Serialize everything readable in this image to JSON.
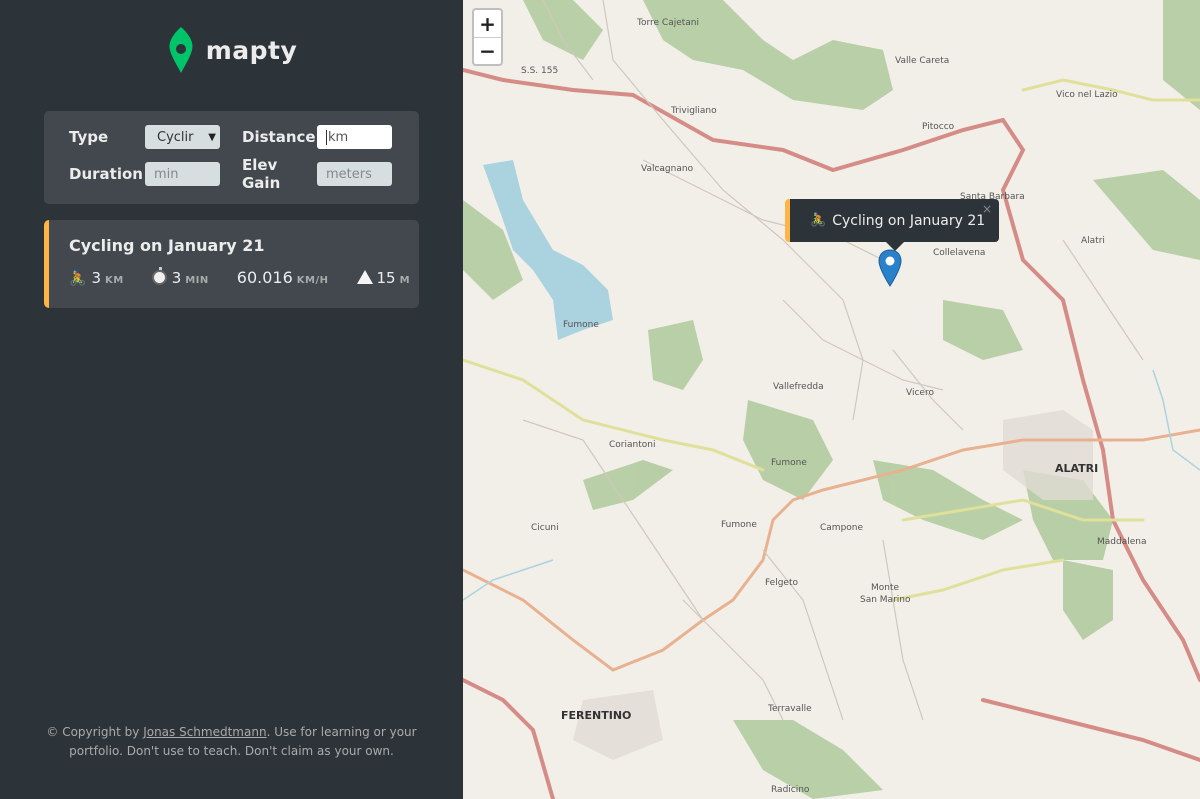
{
  "app": {
    "name": "mapty",
    "brand_color": "#00c46a",
    "accent_cycling": "#ffb545"
  },
  "form": {
    "type_label": "Type",
    "type_value": "Cyclir",
    "distance_label": "Distance",
    "distance_placeholder": "km",
    "duration_label": "Duration",
    "duration_placeholder": "min",
    "elev_label": "Elev Gain",
    "elev_placeholder": "meters"
  },
  "workouts": [
    {
      "title": "Cycling on January 21",
      "distance": "3",
      "distance_unit": "km",
      "duration": "3",
      "duration_unit": "min",
      "speed": "60.016",
      "speed_unit": "km/h",
      "elev": "15",
      "elev_unit": "m"
    }
  ],
  "copyright": {
    "prefix": "© Copyright by ",
    "author": "Jonas Schmedtmann",
    "suffix": ". Use for learning or your portfolio. Don't use to teach. Don't claim as your own."
  },
  "map": {
    "zoom_in": "+",
    "zoom_out": "−",
    "popup_text": "Cycling on January 21",
    "popup_close": "×",
    "labels": {
      "torre_cajetani": "Torre Cajetani",
      "ss155": "S.S. 155",
      "vico_nel_lazio": "Vico nel Lazio",
      "valle_careta": "Valle Careta",
      "trivigliano": "Trivigliano",
      "pitocco": "Pitocco",
      "valcagnano": "Valcagnano",
      "santa_barbara": "Santa Barbara",
      "collelavena": "Collelavena",
      "alatri_road": "Alatri",
      "fumone_lake": "Fumone",
      "vallefredda": "Vallefredda",
      "vicero": "Vicero",
      "coriantoni": "Coriantoni",
      "fumone": "Fumone",
      "alatri": "ALATRI",
      "cicuni": "Cicuni",
      "fumone_road": "Fumone",
      "campone": "Campone",
      "maddalena": "Maddalena",
      "felgeto": "Felgeto",
      "monte_san_marino_1": "Monte",
      "monte_san_marino_2": "San Marino",
      "ferentino": "FERENTINO",
      "terravalle": "Terravalle",
      "radicino": "Radicino"
    }
  }
}
